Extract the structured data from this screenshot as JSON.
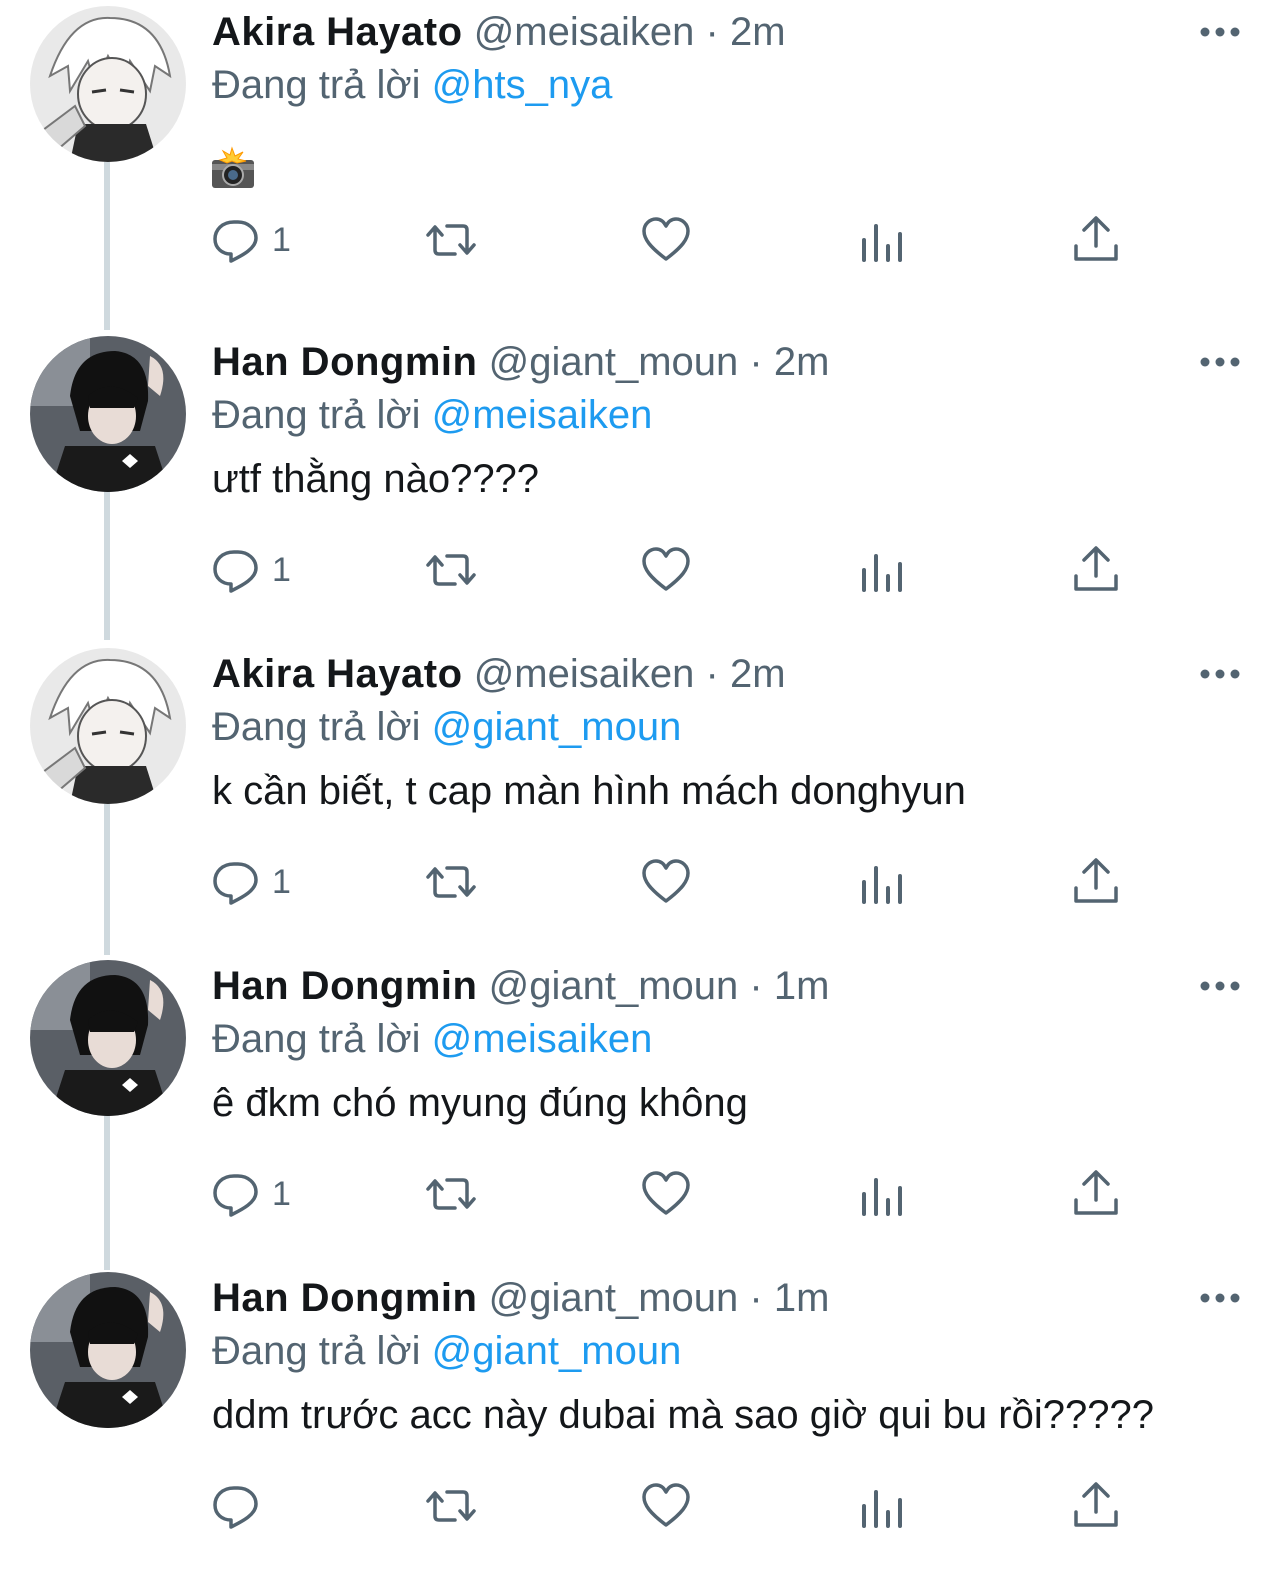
{
  "colors": {
    "name": "#14171a",
    "muted": "#536471",
    "link": "#1d9bf0",
    "thread_line": "#cfd9de"
  },
  "tweets": [
    {
      "author": "Akira Hayato",
      "handle": "@meisaiken",
      "dot": "·",
      "time": "2m",
      "reply_prefix": "Đang trả lời",
      "reply_to": "@hts_nya",
      "text": "",
      "media": "camera-flash-emoji",
      "reply_count": "1",
      "avatar": "anime-white-hair"
    },
    {
      "author": "Han Dongmin",
      "handle": "@giant_moun",
      "dot": "·",
      "time": "2m",
      "reply_prefix": "Đang trả lời",
      "reply_to": "@meisaiken",
      "text": "ưtf thằng nào????",
      "reply_count": "1",
      "avatar": "dark-hair-photo"
    },
    {
      "author": "Akira Hayato",
      "handle": "@meisaiken",
      "dot": "·",
      "time": "2m",
      "reply_prefix": "Đang trả lời",
      "reply_to": "@giant_moun",
      "text": "k cần biết, t cap màn hình mách donghyun",
      "reply_count": "1",
      "avatar": "anime-white-hair"
    },
    {
      "author": "Han Dongmin",
      "handle": "@giant_moun",
      "dot": "·",
      "time": "1m",
      "reply_prefix": "Đang trả lời",
      "reply_to": "@meisaiken",
      "text": "ê đkm chó myung đúng không",
      "reply_count": "1",
      "avatar": "dark-hair-photo"
    },
    {
      "author": "Han Dongmin",
      "handle": "@giant_moun",
      "dot": "·",
      "time": "1m",
      "reply_prefix": "Đang trả lời",
      "reply_to": "@giant_moun",
      "text": "ddm trước acc này dubai mà sao giờ qui bu rồi?????",
      "reply_count": "",
      "avatar": "dark-hair-photo"
    }
  ]
}
